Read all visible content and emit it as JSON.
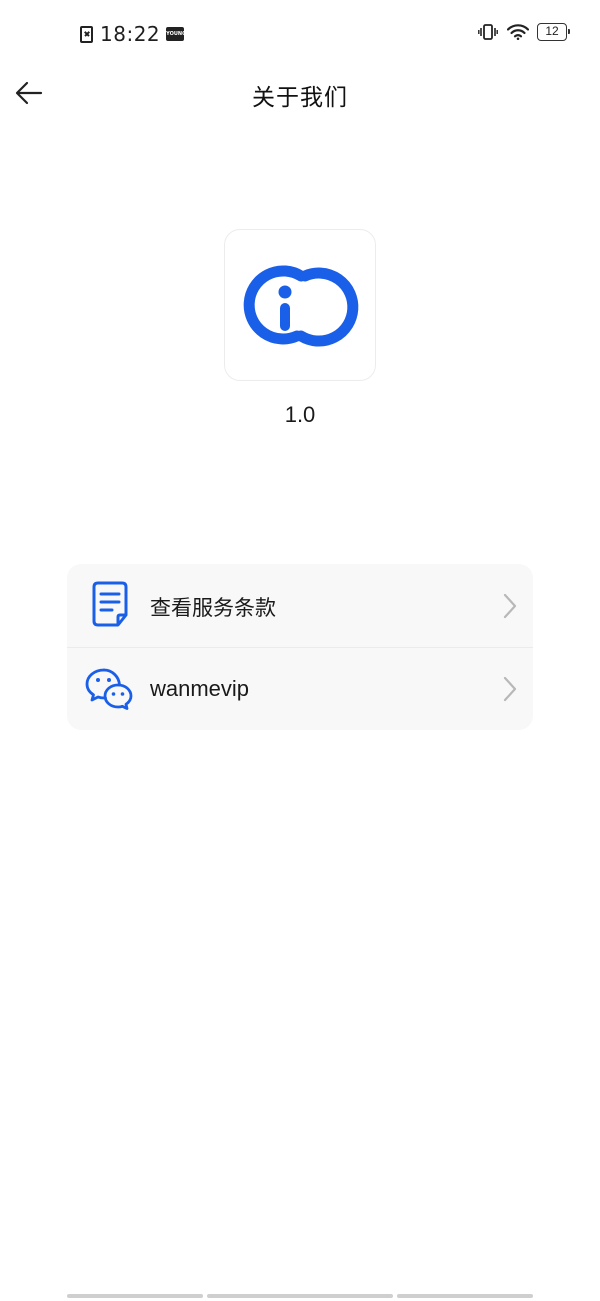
{
  "status_bar": {
    "time": "18:22",
    "badge_text": "YOUNG",
    "battery_level": "12",
    "icons": [
      "sim-card-error-icon",
      "vibrate-icon",
      "wifi-icon",
      "battery-icon"
    ]
  },
  "header": {
    "title": "关于我们",
    "back_icon": "arrow-left-icon"
  },
  "app": {
    "logo_icon": "link-info-logo-icon",
    "version": "1.0",
    "brand_color": "#1a5fe8"
  },
  "menu": {
    "items": [
      {
        "icon": "document-icon",
        "label": "查看服务条款"
      },
      {
        "icon": "wechat-icon",
        "label": "wanmevip"
      }
    ]
  },
  "colors": {
    "accent": "#1a5fe8",
    "card_bg": "#f8f8f8",
    "chevron": "#b8b8b8"
  }
}
